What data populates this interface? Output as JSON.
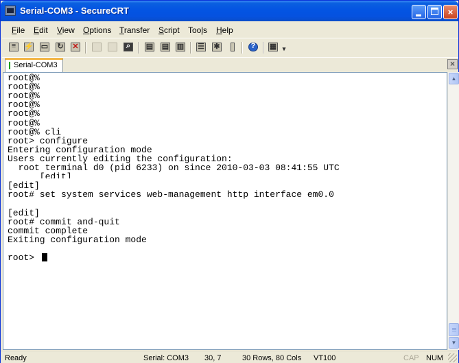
{
  "window": {
    "title": "Serial-COM3 - SecureCRT",
    "controls": {
      "minimize": "minimize",
      "maximize": "maximize",
      "close": "×"
    }
  },
  "menu": [
    {
      "label": "File",
      "accel": "F",
      "rest": "ile"
    },
    {
      "label": "Edit",
      "accel": "E",
      "rest": "dit"
    },
    {
      "label": "View",
      "accel": "V",
      "rest": "iew"
    },
    {
      "label": "Options",
      "accel": "O",
      "rest": "ptions"
    },
    {
      "label": "Transfer",
      "accel": "T",
      "rest": "ransfer"
    },
    {
      "label": "Script",
      "accel": "S",
      "rest": "cript"
    },
    {
      "label": "Tools",
      "pre": "Too",
      "accel": "l",
      "rest": "s"
    },
    {
      "label": "Help",
      "accel": "H",
      "rest": "elp"
    }
  ],
  "toolbar_icons": [
    "connect-icon",
    "quick-connect-icon",
    "connect-in-tab-icon",
    "reconnect-icon",
    "disconnect-icon",
    "copy-icon",
    "paste-icon",
    "find-icon",
    "print-icon",
    "print-selection-icon",
    "print-setup-icon",
    "session-options-icon",
    "global-options-icon",
    "keymap-icon",
    "help-icon",
    "sftp-icon",
    "toolbar-dropdown-icon"
  ],
  "tab": {
    "label": "Serial-COM3",
    "close": "×"
  },
  "terminal": {
    "lines": [
      "root@%",
      "root@%",
      "root@%",
      "root@%",
      "root@%",
      "root@%",
      "root@% cli",
      "root> configure",
      "Entering configuration mode",
      "Users currently editing the configuration:",
      "  root terminal d0 (pid 6233) on since 2010-03-03 08:41:55 UTC",
      "      [edit]",
      "[edit]",
      "root# set system services web-management http interface em0.0",
      "",
      "[edit]",
      "root# commit and-quit",
      "commit complete",
      "Exiting configuration mode",
      "",
      "root> "
    ]
  },
  "status": {
    "state": "Ready",
    "connection": "Serial: COM3",
    "cursor_pos": "30,  7",
    "dimensions": "30 Rows,  80 Cols",
    "emulation": "VT100",
    "caps": "CAP",
    "num": "NUM"
  },
  "colors": {
    "titlebar": "#0454e2",
    "window_bg": "#ece9d8",
    "terminal_bg": "#ffffff",
    "terminal_fg": "#000000",
    "tab_accent": "#f2a51a"
  }
}
